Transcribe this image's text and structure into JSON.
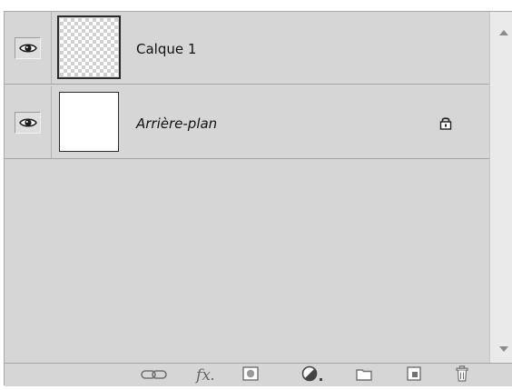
{
  "layers": [
    {
      "name": "Calque 1",
      "visible_icon": "eye-icon",
      "thumbnail": "transparent"
    },
    {
      "name": "Arrière-plan",
      "visible_icon": "eye-icon",
      "thumbnail": "white",
      "locked_icon": "lock-icon"
    }
  ],
  "footer": {
    "fx_label": "fx",
    "icons": [
      "link-layers-icon",
      "fx-icon",
      "layer-mask-icon",
      "adjustment-layer-icon",
      "new-group-icon",
      "new-layer-icon",
      "trash-icon"
    ]
  },
  "colors": {
    "panel_bg": "#d6d6d6",
    "divider": "#a5a5a5",
    "scrollbar_bg": "#eaeaea",
    "icon_gray": "#707070"
  }
}
